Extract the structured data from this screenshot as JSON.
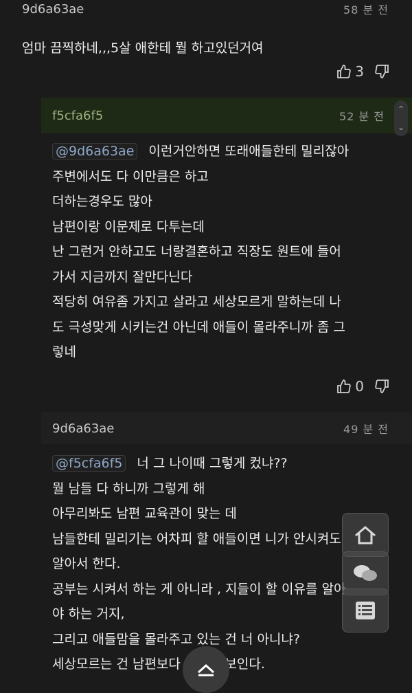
{
  "comments": [
    {
      "author": "9d6a63ae",
      "time": "58 분 전",
      "lines": [
        "엄마 끔찍하네,,,5살 애한테 뭘 하고있던거여"
      ],
      "likes": "3"
    },
    {
      "author": "f5cfa6f5",
      "time": "52 분 전",
      "mention": "@9d6a63ae",
      "lines": [
        "이런거안하면 또래애들한테 밀리잖아",
        "주변에서도 다 이만큼은 하고",
        "더하는경우도 많아",
        "남편이랑 이문제로 다투는데",
        "난 그런거 안하고도 너랑결혼하고 직장도 원트에 들어",
        "가서 지금까지 잘만다닌다",
        "적당히 여유좀 가지고 살라고 세상모르게 말하는데 나",
        "도 극성맞게 시키는건 아닌데 애들이 몰라주니까 좀 그",
        "렇네"
      ],
      "likes": "0"
    },
    {
      "author": "9d6a63ae",
      "time": "49 분 전",
      "mention": "@f5cfa6f5",
      "lines": [
        "너 그 나이때 그렇게 컸냐??",
        "뭘 남들 다 하니까 그렇게 해",
        "아무리봐도 남편 교육관이 맞는 데",
        "남들한테 밀리기는 어차피 할 애들이면 니가 안시켜도",
        "알아서 한다.",
        "공부는 시켜서 하는 게 아니라 , 지들이 할 이유를 알아",
        "야 하는 거지,",
        "그리고 애들맘을 몰라주고 있는 건 너 아니냐?",
        "세상모르는 건 남편보다 너 같아보인다."
      ]
    }
  ],
  "icons": {
    "like": "thumbs-up-icon",
    "dislike": "thumbs-down-icon",
    "home": "home-icon",
    "chat": "chat-icon",
    "list": "list-icon",
    "top": "chevron-up-icon"
  }
}
